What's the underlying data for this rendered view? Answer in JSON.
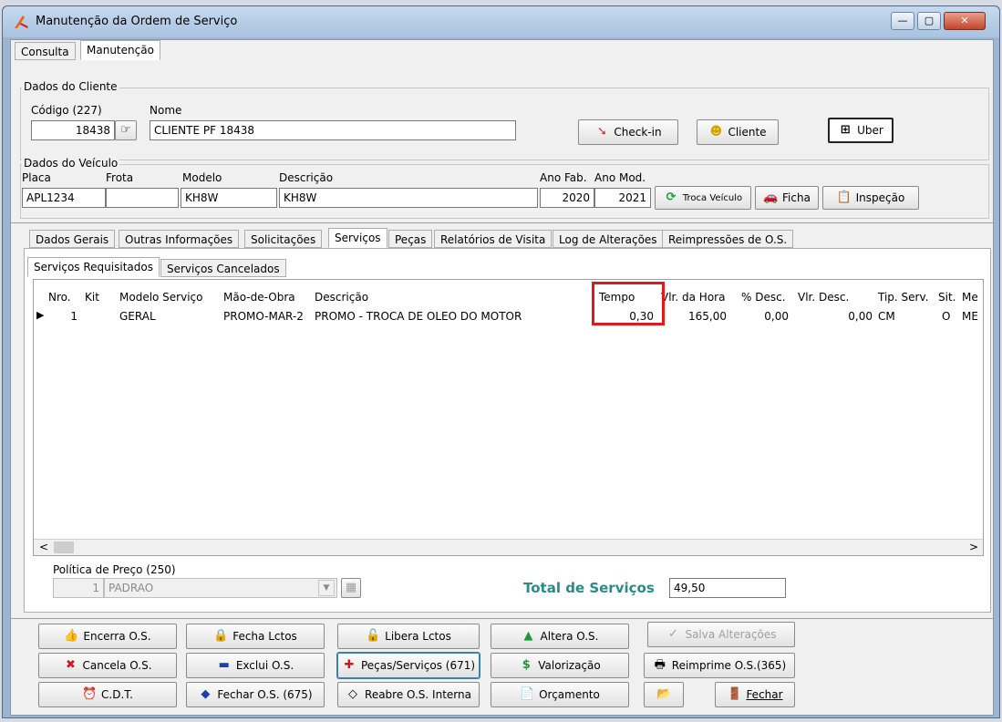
{
  "window": {
    "title": "Manutenção da Ordem de Serviço",
    "controls": [
      "—",
      "▢",
      "✕"
    ]
  },
  "top_tabs": [
    {
      "label": "Consulta",
      "active": false
    },
    {
      "label": "Manutenção",
      "active": true
    }
  ],
  "cliente": {
    "group_label": "Dados do Cliente",
    "codigo_label": "Código (227)",
    "codigo_value": "18438",
    "nome_label": "Nome",
    "nome_value": "CLIENTE PF 18438",
    "checkin_label": "Check-in",
    "cliente_button_label": "Cliente",
    "uber_label": "Uber"
  },
  "veiculo": {
    "group_label": "Dados do Veículo",
    "placa_label": "Placa",
    "placa_value": "APL1234",
    "frota_label": "Frota",
    "frota_value": "",
    "modelo_label": "Modelo",
    "modelo_value": "KH8W",
    "descricao_label": "Descrição",
    "descricao_value": "KH8W",
    "anofab_label": "Ano Fab.",
    "anofab_value": "2020",
    "anomod_label": "Ano Mod.",
    "anomod_value": "2021",
    "troca_label": "Troca Veículo",
    "ficha_label": "Ficha",
    "inspecao_label": "Inspeção"
  },
  "detail_tabs": [
    "Dados Gerais",
    "Outras Informações",
    "Solicitações",
    "Serviços",
    "Peças",
    "Relatórios de Visita",
    "Log de Alterações",
    "Reimpressões de O.S."
  ],
  "detail_active": "Serviços",
  "service_tabs": [
    "Serviços Requisitados",
    "Serviços Cancelados"
  ],
  "grid": {
    "columns": [
      "Nro.",
      "Kit",
      "Modelo Serviço",
      "Mão-de-Obra",
      "Descrição",
      "Tempo",
      "Vlr. da Hora",
      "% Desc.",
      "Vlr. Desc.",
      "Tip. Serv.",
      "Sit.",
      "Me"
    ],
    "rows": [
      {
        "nro": "1",
        "kit": "",
        "modelo": "GERAL",
        "mao": "PROMO-MAR-2",
        "descricao": "PROMO - TROCA DE OLEO DO MOTOR",
        "tempo": "0,30",
        "vlr_hora": "165,00",
        "pct_desc": "0,00",
        "vlr_desc": "0,00",
        "tip": "CM",
        "sit": "O",
        "me": "ME"
      }
    ],
    "highlight_color": "#e0191b"
  },
  "politica": {
    "label": "Política de Preço (250)",
    "code": "1",
    "name": "PADRAO"
  },
  "total": {
    "label": "Total de Serviços",
    "value": "49,50"
  },
  "actions": {
    "encerra": "Encerra O.S.",
    "fecha_lctos": "Fecha Lctos",
    "libera_lctos": "Libera Lctos",
    "altera": "Altera O.S.",
    "salva": "Salva Alterações",
    "cancela": "Cancela O.S.",
    "exclui": "Exclui O.S.",
    "pecas": "Peças/Serviços (671)",
    "valorizacao": "Valorização",
    "reimprime": "Reimprime O.S.(365)",
    "cdt": "C.D.T.",
    "fechar_os": "Fechar O.S. (675)",
    "reabre": "Reabre O.S. Interna",
    "orcamento": "Orçamento",
    "fechar": "Fechar"
  }
}
